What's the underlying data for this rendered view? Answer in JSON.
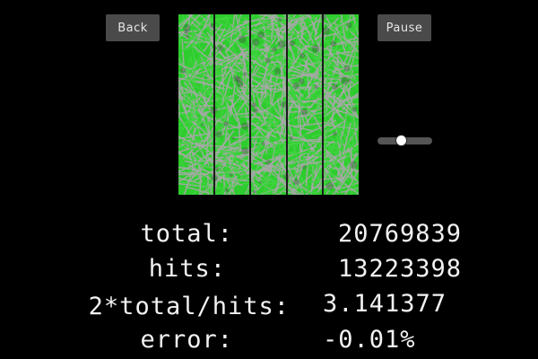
{
  "controls": {
    "back_label": "Back",
    "pause_label": "Pause",
    "speed_level": 0.42
  },
  "stats": {
    "total_label": "total:",
    "total_value": "20769839",
    "hits_label": "hits:",
    "hits_value": "13223398",
    "ratio_label": "2*total/hits:",
    "ratio_value": "3.141377",
    "error_label": "error:",
    "error_value": "-0.01%"
  },
  "colors": {
    "background": "#000000",
    "canvas_green": "#2ecc2e",
    "needle_gray": "#a8a8a8",
    "line_color": "#1a1a1a",
    "button_bg": "#4a4a4a"
  },
  "simulation": {
    "name": "buffon-needle",
    "num_lines": 4
  }
}
